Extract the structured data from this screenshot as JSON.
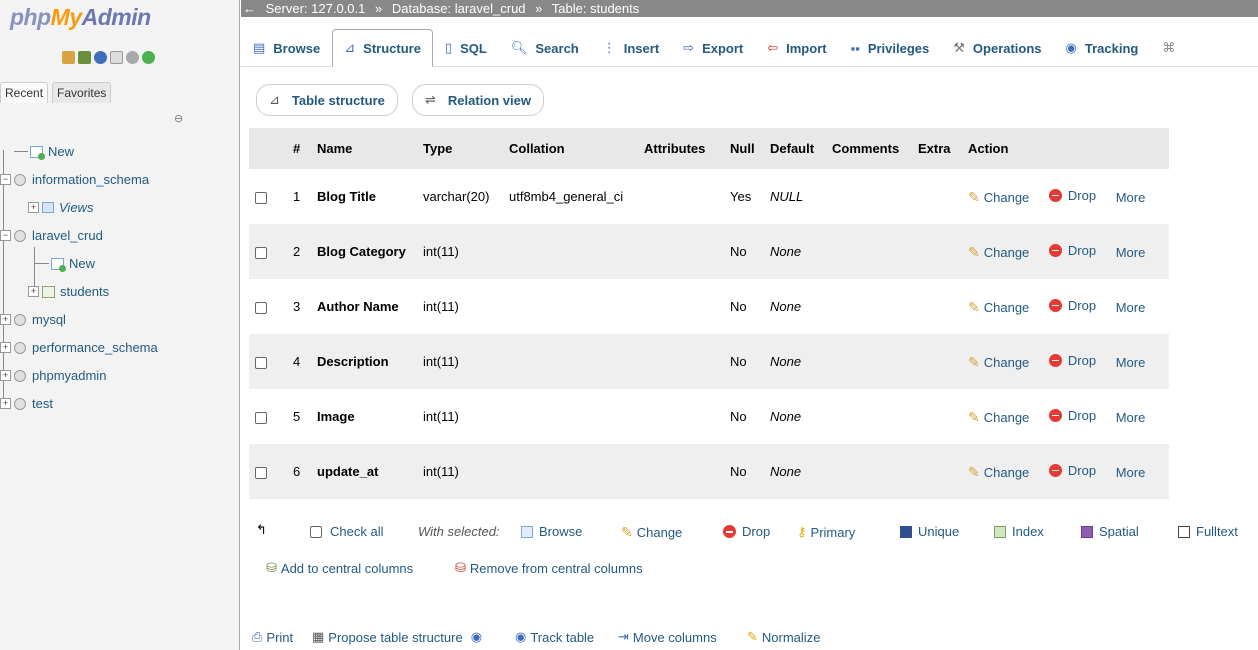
{
  "nav": {
    "logo": {
      "php": "php",
      "my": "My",
      "admin": "Admin"
    },
    "tabs": [
      "Recent",
      "Favorites"
    ],
    "tree": {
      "new": "New",
      "information_schema": "information_schema",
      "views": "Views",
      "laravel_crud": "laravel_crud",
      "laravel_new": "New",
      "students": "students",
      "mysql": "mysql",
      "performance_schema": "performance_schema",
      "phpmyadmin": "phpmyadmin",
      "test": "test"
    }
  },
  "breadcrumb": {
    "server": "Server: 127.0.0.1",
    "sep": "»",
    "database": "Database: laravel_crud",
    "table": "Table: students"
  },
  "topmenu": [
    "Browse",
    "Structure",
    "SQL",
    "Search",
    "Insert",
    "Export",
    "Import",
    "Privileges",
    "Operations",
    "Tracking"
  ],
  "subtabs": {
    "table_structure": "Table structure",
    "relation_view": "Relation view"
  },
  "table": {
    "headers": [
      "#",
      "Name",
      "Type",
      "Collation",
      "Attributes",
      "Null",
      "Default",
      "Comments",
      "Extra",
      "Action"
    ],
    "rows": [
      {
        "num": "1",
        "name": "Blog Title",
        "type": "varchar(20)",
        "collation": "utf8mb4_general_ci",
        "null": "Yes",
        "default": "NULL"
      },
      {
        "num": "2",
        "name": "Blog Category",
        "type": "int(11)",
        "collation": "",
        "null": "No",
        "default": "None"
      },
      {
        "num": "3",
        "name": "Author Name",
        "type": "int(11)",
        "collation": "",
        "null": "No",
        "default": "None"
      },
      {
        "num": "4",
        "name": "Description",
        "type": "int(11)",
        "collation": "",
        "null": "No",
        "default": "None"
      },
      {
        "num": "5",
        "name": "Image",
        "type": "int(11)",
        "collation": "",
        "null": "No",
        "default": "None"
      },
      {
        "num": "6",
        "name": "update_at",
        "type": "int(11)",
        "collation": "",
        "null": "No",
        "default": "None"
      }
    ],
    "actions": {
      "change": "Change",
      "drop": "Drop",
      "more": "More"
    }
  },
  "bulk": {
    "check_all": "Check all",
    "with_selected": "With selected:",
    "browse": "Browse",
    "change": "Change",
    "drop": "Drop",
    "primary": "Primary",
    "unique": "Unique",
    "index": "Index",
    "spatial": "Spatial",
    "fulltext": "Fulltext",
    "add_central": "Add to central columns",
    "remove_central": "Remove from central columns"
  },
  "footer": {
    "print": "Print",
    "propose": "Propose table structure",
    "track": "Track table",
    "move": "Move columns",
    "normalize": "Normalize"
  },
  "colors": {
    "link": "#235a81",
    "header_bg": "#e8e8e8",
    "even_row": "#efefef",
    "breadcrumb_bg": "#888888"
  }
}
